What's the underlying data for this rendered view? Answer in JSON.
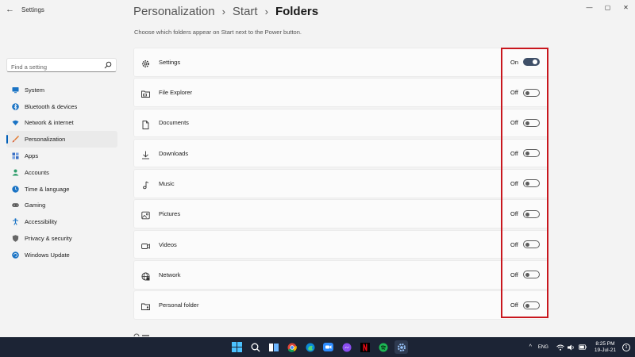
{
  "window": {
    "title": "Settings",
    "controls": {
      "minimize": "—",
      "maximize": "▢",
      "close": "✕"
    }
  },
  "sidebar": {
    "search_placeholder": "Find a setting",
    "items": [
      {
        "label": "System",
        "icon": "monitor-icon",
        "color": "#1a73c4"
      },
      {
        "label": "Bluetooth & devices",
        "icon": "bluetooth-icon",
        "color": "#1a73c4"
      },
      {
        "label": "Network & internet",
        "icon": "wifi-icon",
        "color": "#1a73c4"
      },
      {
        "label": "Personalization",
        "icon": "brush-icon",
        "color": "#e2762b",
        "active": true
      },
      {
        "label": "Apps",
        "icon": "apps-icon",
        "color": "#3a6fc4"
      },
      {
        "label": "Accounts",
        "icon": "person-icon",
        "color": "#2f9e6b"
      },
      {
        "label": "Time & language",
        "icon": "globe-clock-icon",
        "color": "#1a73c4"
      },
      {
        "label": "Gaming",
        "icon": "gamepad-icon",
        "color": "#555555"
      },
      {
        "label": "Accessibility",
        "icon": "accessibility-icon",
        "color": "#1a73c4"
      },
      {
        "label": "Privacy & security",
        "icon": "shield-icon",
        "color": "#666666"
      },
      {
        "label": "Windows Update",
        "icon": "update-icon",
        "color": "#1a73c4"
      }
    ]
  },
  "header": {
    "breadcrumb": [
      "Personalization",
      "Start",
      "Folders"
    ],
    "separator": "›",
    "subtitle": "Choose which folders appear on Start next to the Power button."
  },
  "folders": [
    {
      "label": "Settings",
      "state": "On",
      "on": true,
      "icon": "gear-icon"
    },
    {
      "label": "File Explorer",
      "state": "Off",
      "on": false,
      "icon": "file-explorer-icon"
    },
    {
      "label": "Documents",
      "state": "Off",
      "on": false,
      "icon": "document-icon"
    },
    {
      "label": "Downloads",
      "state": "Off",
      "on": false,
      "icon": "download-icon"
    },
    {
      "label": "Music",
      "state": "Off",
      "on": false,
      "icon": "music-note-icon"
    },
    {
      "label": "Pictures",
      "state": "Off",
      "on": false,
      "icon": "picture-icon"
    },
    {
      "label": "Videos",
      "state": "Off",
      "on": false,
      "icon": "video-icon"
    },
    {
      "label": "Network",
      "state": "Off",
      "on": false,
      "icon": "network-globe-icon"
    },
    {
      "label": "Personal folder",
      "state": "Off",
      "on": false,
      "icon": "personal-folder-icon"
    }
  ],
  "taskbar": {
    "language": "ENG",
    "time": "8:25 PM",
    "date": "19-Jul-21",
    "notification_count": "1",
    "accent": "#1c2435"
  }
}
